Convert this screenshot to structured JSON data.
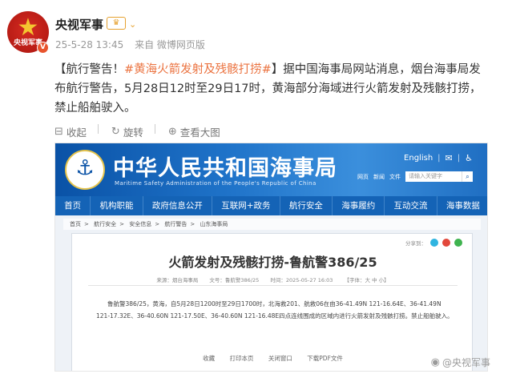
{
  "post": {
    "author": "央视军事",
    "avatar_text": "央视军事",
    "vip_badge": "VIP",
    "timestamp": "25-5-28 13:45",
    "source": "来自 微博网页版",
    "text_prefix": "【航行警告！",
    "topic": "#黄海火箭发射及残骸打捞#",
    "text_rest": "】据中国海事局网站消息，烟台海事局发布航行警告，5月28日12时至29日17时，黄海部分海域进行火箭发射及残骸打捞，禁止船舶驶入。",
    "actions": {
      "collect": "收起",
      "repost": "旋转",
      "view_image": "查看大图"
    }
  },
  "site": {
    "title": "中华人民共和国海事局",
    "subtitle": "Maritime Safety Administration of the People's Republic of China",
    "lang": "English",
    "tabs": [
      "网页",
      "新闻",
      "文件"
    ],
    "search_placeholder": "请输入关键字",
    "nav": [
      "首页",
      "机构职能",
      "政府信息公开",
      "互联网+政务",
      "航行安全",
      "海事履约",
      "互动交流",
      "海事数据"
    ],
    "breadcrumb": [
      "首页",
      "航行安全",
      "安全信息",
      "航行警告",
      "山东海事局"
    ],
    "share_label": "分享到：",
    "article": {
      "title": "火箭发射及残骸打捞-鲁航警386/25",
      "source": "来源：烟台海事局",
      "doc_no": "文号：鲁航警386/25",
      "time": "时间：2025-05-27 16:03",
      "font_size": "【字体：大 中 小】",
      "body": "鲁航警386/25，黄海，自5月28日1200时至29日1700时，北海救201、航救06在由36-41.49N 121-16.64E、36-41.49N 121-17.32E、36-40.60N 121-17.50E、36-40.60N 121-16.48E四点连线围成的区域内进行火箭发射及残骸打捞。禁止船舶驶入。",
      "footer": [
        "收藏",
        "打印本页",
        "关闭窗口",
        "下载PDF文件"
      ]
    }
  },
  "watermark": "@央视军事"
}
